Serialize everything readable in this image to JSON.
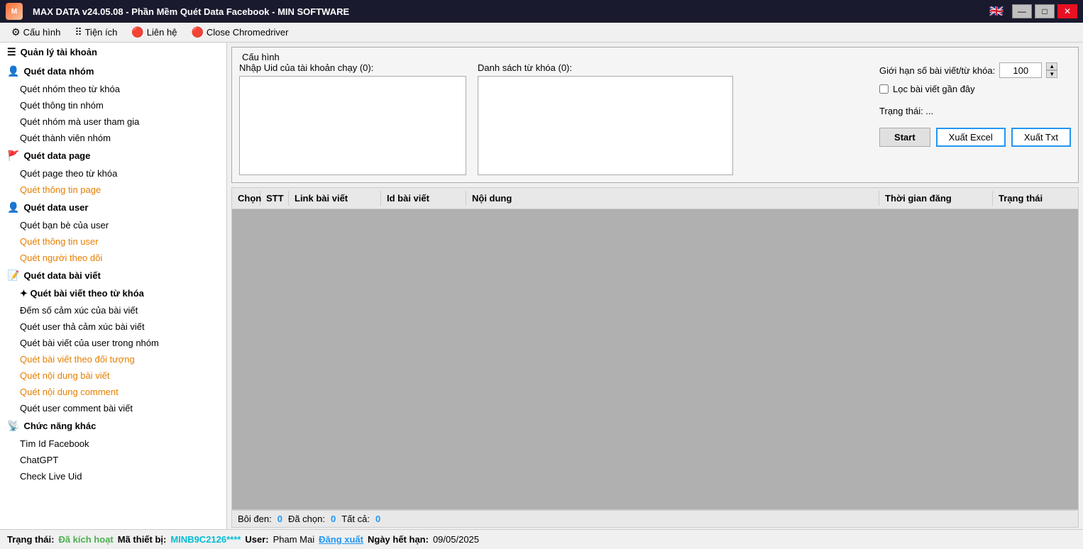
{
  "titleBar": {
    "title": "MAX DATA v24.05.08 - Phần Mềm Quét Data Facebook - MIN SOFTWARE",
    "logoText": "M",
    "minimizeLabel": "—",
    "maximizeLabel": "□",
    "closeLabel": "✕"
  },
  "menuBar": {
    "items": [
      {
        "id": "cauhinh",
        "icon": "⚙",
        "label": "Cấu hình"
      },
      {
        "id": "tienich",
        "icon": "⋯",
        "label": "Tiện ích"
      },
      {
        "id": "lienhe",
        "icon": "🔴",
        "label": "Liên hệ"
      },
      {
        "id": "closedriver",
        "icon": "🔴",
        "label": "Close Chromedriver"
      }
    ]
  },
  "sidebar": {
    "sections": [
      {
        "id": "quan-ly-tai-khoan",
        "icon": "☰",
        "label": "Quản lý tài khoản",
        "items": []
      },
      {
        "id": "quet-data-nhom",
        "icon": "👤",
        "label": "Quét data nhóm",
        "items": [
          {
            "id": "quet-nhom-theo-tu-khoa",
            "label": "Quét nhóm theo từ khóa",
            "style": "normal"
          },
          {
            "id": "quet-thong-tin-nhom",
            "label": "Quét thông tin nhóm",
            "style": "normal"
          },
          {
            "id": "quet-nhom-ma-user-tham-gia",
            "label": "Quét nhóm mà user tham gia",
            "style": "normal"
          },
          {
            "id": "quet-thanh-vien-nhom",
            "label": "Quét thành viên nhóm",
            "style": "normal"
          }
        ]
      },
      {
        "id": "quet-data-page",
        "icon": "🚩",
        "label": "Quét data page",
        "items": [
          {
            "id": "quet-page-theo-tu-khoa",
            "label": "Quét page theo từ khóa",
            "style": "normal"
          },
          {
            "id": "quet-thong-tin-page",
            "label": "Quét thông tin page",
            "style": "orange"
          }
        ]
      },
      {
        "id": "quet-data-user",
        "icon": "👤",
        "label": "Quét data user",
        "items": [
          {
            "id": "quet-ban-be-cua-user",
            "label": "Quét bạn bè của user",
            "style": "normal"
          },
          {
            "id": "quet-thong-tin-user",
            "label": "Quét thông tin user",
            "style": "orange"
          },
          {
            "id": "quet-nguoi-theo-doi",
            "label": "Quét người theo dõi",
            "style": "orange"
          }
        ]
      },
      {
        "id": "quet-data-bai-viet",
        "icon": "📝",
        "label": "Quét data bài viết",
        "items": [
          {
            "id": "quet-bai-viet-theo-tu-khoa",
            "label": "✦ Quét bài viết theo từ khóa",
            "style": "bold"
          },
          {
            "id": "dem-so-cam-xuc",
            "label": "Đếm số cảm xúc của bài viết",
            "style": "normal"
          },
          {
            "id": "quet-user-tha-cam-xuc",
            "label": "Quét user thả cảm xúc bài viết",
            "style": "normal"
          },
          {
            "id": "quet-bai-viet-cua-user-trong-nhom",
            "label": "Quét bài viết của user trong nhóm",
            "style": "normal"
          },
          {
            "id": "quet-bai-viet-theo-doi-tuong",
            "label": "Quét bài viết theo đối tượng",
            "style": "orange"
          },
          {
            "id": "quet-noi-dung-bai-viet",
            "label": "Quét nội dung bài viết",
            "style": "orange"
          },
          {
            "id": "quet-noi-dung-comment",
            "label": "Quét nội dung comment",
            "style": "orange"
          },
          {
            "id": "quet-user-comment-bai-viet",
            "label": "Quét user comment bài viết",
            "style": "normal"
          }
        ]
      },
      {
        "id": "chuc-nang-khac",
        "icon": "📡",
        "label": "Chức năng khác",
        "items": [
          {
            "id": "tim-id-facebook",
            "label": "Tìm Id Facebook",
            "style": "normal"
          },
          {
            "id": "chatgpt",
            "label": "ChatGPT",
            "style": "normal"
          },
          {
            "id": "check-live-uid",
            "label": "Check Live Uid",
            "style": "normal"
          }
        ]
      }
    ]
  },
  "config": {
    "legend": "Cấu hình",
    "uidLabel": "Nhập Uid của tài khoản chạy (0):",
    "keywordLabel": "Danh sách từ khóa (0):",
    "limitLabel": "Giới hạn số bài viết/từ khóa:",
    "limitValue": "100",
    "filterLabel": "Lọc bài viết gần đây",
    "statusLabel": "Trạng thái:",
    "statusValue": "...",
    "startLabel": "Start",
    "exportExcelLabel": "Xuất Excel",
    "exportTxtLabel": "Xuất Txt"
  },
  "table": {
    "columns": [
      {
        "id": "chon",
        "label": "Chọn"
      },
      {
        "id": "stt",
        "label": "STT"
      },
      {
        "id": "link-bai-viet",
        "label": "Link bài viết"
      },
      {
        "id": "id-bai-viet",
        "label": "Id bài viết"
      },
      {
        "id": "noi-dung",
        "label": "Nội dung"
      },
      {
        "id": "thoi-gian-dang",
        "label": "Thời gian đăng"
      },
      {
        "id": "trang-thai",
        "label": "Trạng thái"
      }
    ],
    "rows": []
  },
  "tableFooter": {
    "boiDenLabel": "Bôi đen:",
    "boiDenValue": "0",
    "daChonLabel": "Đã chọn:",
    "daChonValue": "0",
    "tatCaLabel": "Tất cả:",
    "tatCaValue": "0"
  },
  "statusBar": {
    "trangThaiLabel": "Trạng thái:",
    "trangThaiValue": "Đã kích hoạt",
    "maThietBiLabel": "Mã thiết bị:",
    "maThietBiValue": "MINB9C2126****",
    "userLabel": "User:",
    "userValue": "Pham Mai",
    "dangXuatLabel": "Đăng xuất",
    "ngayHetHanLabel": "Ngày hết hạn:",
    "ngayHetHanValue": "09/05/2025"
  }
}
